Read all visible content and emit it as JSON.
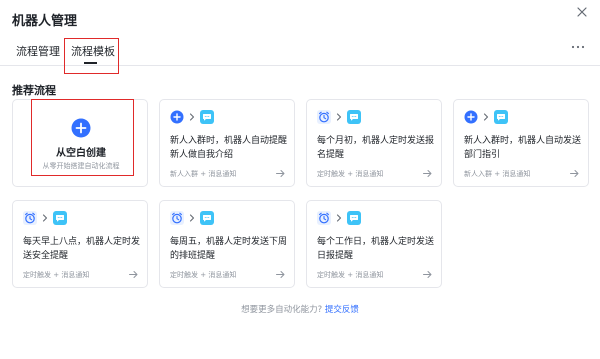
{
  "dialog": {
    "title": "机器人管理"
  },
  "tabs": [
    {
      "label": "流程管理"
    },
    {
      "label": "流程模板"
    }
  ],
  "section": {
    "title": "推荐流程"
  },
  "blank_card": {
    "title": "从空白创建",
    "subtitle": "从零开始搭建自动化流程"
  },
  "templates": [
    {
      "text": "新人入群时，机器人自动提醒新人做自我介绍",
      "trigger": "新人入群",
      "action": "消息通知",
      "trigger_icon": "plus-circle-icon",
      "action_icon": "message-icon"
    },
    {
      "text": "每个月初，机器人定时发送报名提醒",
      "trigger": "定时触发",
      "action": "消息通知",
      "trigger_icon": "alarm-clock-icon",
      "action_icon": "message-icon"
    },
    {
      "text": "新人入群时，机器人自动发送部门指引",
      "trigger": "新人入群",
      "action": "消息通知",
      "trigger_icon": "plus-circle-icon",
      "action_icon": "message-icon"
    },
    {
      "text": "每天早上八点，机器人定时发送安全提醒",
      "trigger": "定时触发",
      "action": "消息通知",
      "trigger_icon": "alarm-clock-icon",
      "action_icon": "message-icon"
    },
    {
      "text": "每周五，机器人定时发送下周的排班提醒",
      "trigger": "定时触发",
      "action": "消息通知",
      "trigger_icon": "alarm-clock-icon",
      "action_icon": "message-icon"
    },
    {
      "text": "每个工作日，机器人定时发送日报提醒",
      "trigger": "定时触发",
      "action": "消息通知",
      "trigger_icon": "alarm-clock-icon",
      "action_icon": "message-icon"
    }
  ],
  "footer": {
    "question": "想要更多自动化能力?",
    "link": "提交反馈"
  },
  "colors": {
    "accent": "#3370ff",
    "highlight": "#e02a2a",
    "action_icon_bg": "#3ec3f7",
    "border": "#e5e6eb",
    "muted_text": "#8f959e"
  }
}
